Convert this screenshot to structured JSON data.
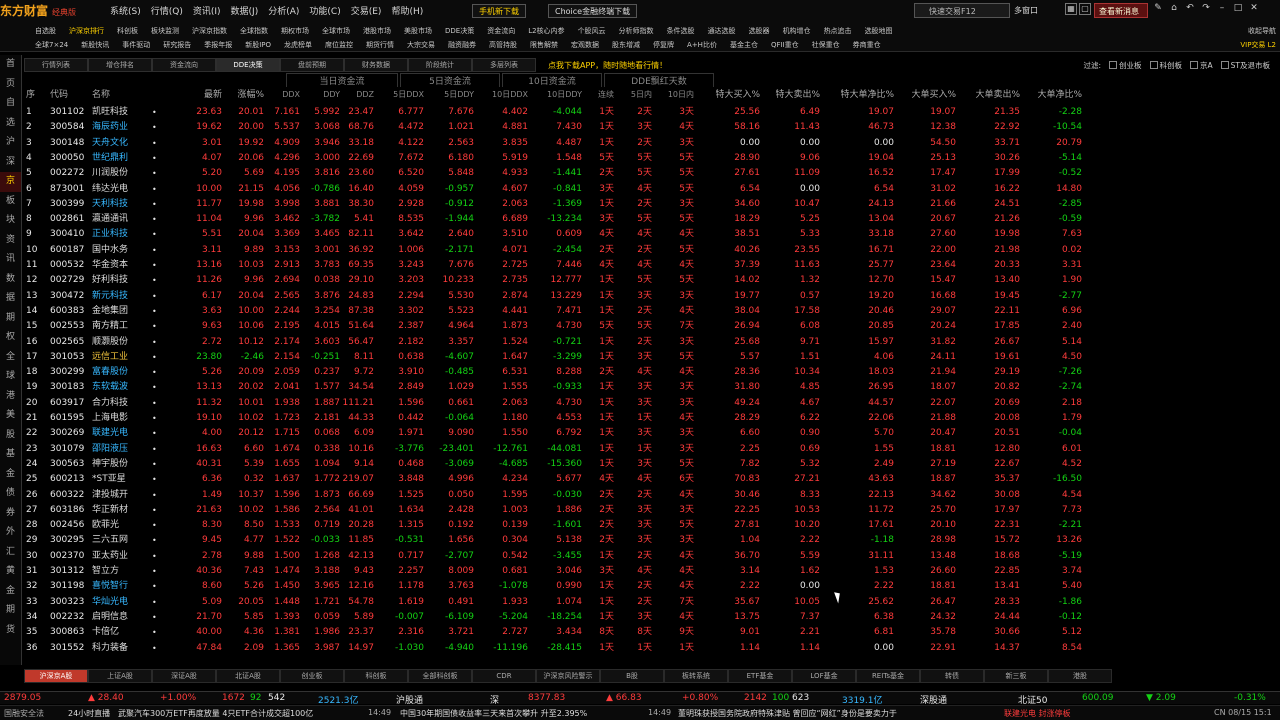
{
  "app": {
    "logo": "东方财富",
    "edition": "经典版"
  },
  "menu": [
    "系统(S)",
    "行情(Q)",
    "资讯(I)",
    "数据(J)",
    "分析(A)",
    "功能(C)",
    "交易(E)",
    "帮助(H)"
  ],
  "top_buttons": {
    "mobile": "手机新下载",
    "choice": "Choice金融终端下载"
  },
  "search_placeholder": "快速交易F12",
  "multi_window": "多窗口",
  "message_btn": "查看新消息",
  "subnav_row1": [
    "自选股",
    "沪深京排行",
    "科创板",
    "板块监测",
    "沪深京指数",
    "全球指数",
    "期权市场",
    "全球市场",
    "港股市场",
    "美股市场",
    "DDE决策",
    "资金流向",
    "L2核心内参",
    "个股风云",
    "分析师指数",
    "条件选股",
    "通达选股",
    "选股器",
    "机构增仓",
    "热点追击",
    "选股地图"
  ],
  "subnav_row2": [
    "全球7×24",
    "新股快讯",
    "事件驱动",
    "研究报告",
    "季报年报",
    "新股IPO",
    "龙虎榜单",
    "席位监控",
    "期货行情",
    "大宗交易",
    "融资融券",
    "高管持股",
    "限售解禁",
    "宏观数据",
    "股东增减",
    "停复牌",
    "A+H比价",
    "基金主仓",
    "QFII重仓",
    "社保重仓",
    "券商重仓"
  ],
  "right_nav1": "收起导航",
  "right_nav2": "VIP交易 L2",
  "sidebar": [
    "首",
    "页",
    "自",
    "选",
    "沪",
    "深",
    "京",
    "板",
    "块",
    "资",
    "讯",
    "数",
    "据",
    "期",
    "权",
    "全",
    "球",
    "港",
    "美",
    "股",
    "基",
    "金",
    "债",
    "券",
    "外",
    "汇",
    "黄",
    "金",
    "期",
    "货"
  ],
  "tabs": [
    "行情列表",
    "增仓排名",
    "资金流向",
    "DDE决策",
    "盘前预期",
    "财务数据",
    "阶段统计",
    "多层列表"
  ],
  "active_tab": 3,
  "promo": "点我下载APP，随时随地看行情！",
  "filters": {
    "label": "过滤:",
    "items": [
      "创业板",
      "科创板",
      "京A",
      "ST及退市板"
    ]
  },
  "header_groups": {
    "today": "当日资金流",
    "five_day": "5日资金流",
    "ten_day": "10日资金流",
    "dde_days": "DDE飘红天数"
  },
  "columns": [
    "序",
    "代码",
    "名称",
    "",
    "最新",
    "涨幅%",
    "DDX",
    "DDY",
    "DDZ",
    "5日DDX",
    "5日DDY",
    "10日DDX",
    "10日DDY",
    "连续",
    "5日内",
    "10日内",
    "特大买入%",
    "特大卖出%",
    "特大单净比%",
    "大单买入%",
    "大单卖出%",
    "大单净比%"
  ],
  "rows": [
    [
      "1",
      "301102",
      "凯旺科技",
      "•",
      "23.63",
      "20.01",
      "7.161",
      "5.992",
      "23.47",
      "6.777",
      "7.676",
      "4.402",
      "-4.044",
      "1天",
      "2天",
      "3天",
      "25.56",
      "6.49",
      "19.07",
      "19.07",
      "21.35",
      "-2.28"
    ],
    [
      "2",
      "300584",
      "海辰药业",
      "•",
      "19.62",
      "20.00",
      "5.537",
      "3.068",
      "68.76",
      "4.472",
      "1.021",
      "4.881",
      "7.430",
      "1天",
      "3天",
      "4天",
      "58.16",
      "11.43",
      "46.73",
      "12.38",
      "22.92",
      "-10.54"
    ],
    [
      "3",
      "300148",
      "天舟文化",
      "•",
      "3.01",
      "19.92",
      "4.909",
      "3.946",
      "33.18",
      "4.122",
      "2.563",
      "3.835",
      "4.487",
      "1天",
      "2天",
      "3天",
      "0.00",
      "0.00",
      "0.00",
      "54.50",
      "33.71",
      "20.79"
    ],
    [
      "4",
      "300050",
      "世纪鼎利",
      "•",
      "4.07",
      "20.06",
      "4.296",
      "3.000",
      "22.69",
      "7.672",
      "6.180",
      "5.919",
      "1.548",
      "5天",
      "5天",
      "5天",
      "28.90",
      "9.06",
      "19.04",
      "25.13",
      "30.26",
      "-5.14"
    ],
    [
      "5",
      "002272",
      "川润股份",
      "•",
      "5.20",
      "5.69",
      "4.195",
      "3.816",
      "23.60",
      "6.520",
      "5.848",
      "4.933",
      "-1.441",
      "2天",
      "5天",
      "5天",
      "27.61",
      "11.09",
      "16.52",
      "17.47",
      "17.99",
      "-0.52"
    ],
    [
      "6",
      "873001",
      "纬达光电",
      "•",
      "10.00",
      "21.15",
      "4.056",
      "-0.786",
      "16.40",
      "4.059",
      "-0.957",
      "4.607",
      "-0.841",
      "3天",
      "4天",
      "5天",
      "6.54",
      "0.00",
      "6.54",
      "31.02",
      "16.22",
      "14.80"
    ],
    [
      "7",
      "300399",
      "天利科技",
      "•",
      "11.77",
      "19.98",
      "3.998",
      "3.881",
      "38.30",
      "2.928",
      "-0.912",
      "2.063",
      "-1.369",
      "1天",
      "2天",
      "3天",
      "34.60",
      "10.47",
      "24.13",
      "21.66",
      "24.51",
      "-2.85"
    ],
    [
      "8",
      "002861",
      "瀛通通讯",
      "•",
      "11.04",
      "9.96",
      "3.462",
      "-3.782",
      "5.41",
      "8.535",
      "-1.944",
      "6.689",
      "-13.234",
      "3天",
      "5天",
      "5天",
      "18.29",
      "5.25",
      "13.04",
      "20.67",
      "21.26",
      "-0.59"
    ],
    [
      "9",
      "300410",
      "正业科技",
      "•",
      "5.51",
      "20.04",
      "3.369",
      "3.465",
      "82.11",
      "3.642",
      "2.640",
      "3.510",
      "0.609",
      "4天",
      "4天",
      "4天",
      "38.51",
      "5.33",
      "33.18",
      "27.60",
      "19.98",
      "7.63"
    ],
    [
      "10",
      "600187",
      "国中水务",
      "•",
      "3.11",
      "9.89",
      "3.153",
      "3.001",
      "36.92",
      "1.006",
      "-2.171",
      "4.071",
      "-2.454",
      "2天",
      "2天",
      "5天",
      "40.26",
      "23.55",
      "16.71",
      "22.00",
      "21.98",
      "0.02"
    ],
    [
      "11",
      "000532",
      "华金资本",
      "•",
      "13.16",
      "10.03",
      "2.913",
      "3.783",
      "69.35",
      "3.243",
      "7.676",
      "2.725",
      "7.446",
      "4天",
      "4天",
      "4天",
      "37.39",
      "11.63",
      "25.77",
      "23.64",
      "20.33",
      "3.31"
    ],
    [
      "12",
      "002729",
      "好利科技",
      "•",
      "11.26",
      "9.96",
      "2.694",
      "0.038",
      "29.10",
      "3.203",
      "10.233",
      "2.735",
      "12.777",
      "1天",
      "5天",
      "5天",
      "14.02",
      "1.32",
      "12.70",
      "15.47",
      "13.40",
      "1.90"
    ],
    [
      "13",
      "300472",
      "新元科技",
      "•",
      "6.17",
      "20.04",
      "2.565",
      "3.876",
      "24.83",
      "2.294",
      "5.530",
      "2.874",
      "13.229",
      "1天",
      "3天",
      "3天",
      "19.77",
      "0.57",
      "19.20",
      "16.68",
      "19.45",
      "-2.77"
    ],
    [
      "14",
      "600383",
      "金地集团",
      "•",
      "3.63",
      "10.00",
      "2.244",
      "3.254",
      "87.38",
      "3.302",
      "5.523",
      "4.441",
      "7.471",
      "1天",
      "2天",
      "4天",
      "38.04",
      "17.58",
      "20.46",
      "29.07",
      "22.11",
      "6.96"
    ],
    [
      "15",
      "002553",
      "南方精工",
      "•",
      "9.63",
      "10.06",
      "2.195",
      "4.015",
      "51.64",
      "2.387",
      "4.964",
      "1.873",
      "4.730",
      "5天",
      "5天",
      "7天",
      "26.94",
      "6.08",
      "20.85",
      "20.24",
      "17.85",
      "2.40"
    ],
    [
      "16",
      "002565",
      "顺灏股份",
      "•",
      "2.72",
      "10.12",
      "2.174",
      "3.603",
      "56.47",
      "2.182",
      "3.357",
      "1.524",
      "-0.721",
      "1天",
      "2天",
      "3天",
      "25.68",
      "9.71",
      "15.97",
      "31.82",
      "26.67",
      "5.14"
    ],
    [
      "17",
      "301053",
      "远信工业",
      "•",
      "23.80",
      "-2.46",
      "2.154",
      "-0.251",
      "8.11",
      "0.638",
      "-4.607",
      "1.647",
      "-3.299",
      "1天",
      "3天",
      "5天",
      "5.57",
      "1.51",
      "4.06",
      "24.11",
      "19.61",
      "4.50"
    ],
    [
      "18",
      "300299",
      "富春股份",
      "•",
      "5.26",
      "20.09",
      "2.059",
      "0.237",
      "9.72",
      "3.910",
      "-0.485",
      "6.531",
      "8.288",
      "2天",
      "4天",
      "4天",
      "28.36",
      "10.34",
      "18.03",
      "21.94",
      "29.19",
      "-7.26"
    ],
    [
      "19",
      "300183",
      "东软载波",
      "•",
      "13.13",
      "20.02",
      "2.041",
      "1.577",
      "34.54",
      "2.849",
      "1.029",
      "1.555",
      "-0.933",
      "1天",
      "3天",
      "3天",
      "31.80",
      "4.85",
      "26.95",
      "18.07",
      "20.82",
      "-2.74"
    ],
    [
      "20",
      "603917",
      "合力科技",
      "•",
      "11.32",
      "10.01",
      "1.938",
      "1.887",
      "111.21",
      "1.596",
      "0.661",
      "2.063",
      "4.730",
      "1天",
      "3天",
      "3天",
      "49.24",
      "4.67",
      "44.57",
      "22.07",
      "20.69",
      "2.18"
    ],
    [
      "21",
      "601595",
      "上海电影",
      "•",
      "19.10",
      "10.02",
      "1.723",
      "2.181",
      "44.33",
      "0.442",
      "-0.064",
      "1.180",
      "4.553",
      "1天",
      "1天",
      "4天",
      "28.29",
      "6.22",
      "22.06",
      "21.88",
      "20.08",
      "1.79"
    ],
    [
      "22",
      "300269",
      "联建光电",
      "•",
      "4.00",
      "20.12",
      "1.715",
      "0.068",
      "6.09",
      "1.971",
      "9.090",
      "1.550",
      "6.792",
      "1天",
      "3天",
      "3天",
      "6.60",
      "0.90",
      "5.70",
      "20.47",
      "20.51",
      "-0.04"
    ],
    [
      "23",
      "301079",
      "邵阳液压",
      "•",
      "16.63",
      "6.60",
      "1.674",
      "0.338",
      "10.16",
      "-3.776",
      "-23.401",
      "-12.761",
      "-44.081",
      "1天",
      "1天",
      "3天",
      "2.25",
      "0.69",
      "1.55",
      "18.81",
      "12.80",
      "6.01"
    ],
    [
      "24",
      "300563",
      "神宇股份",
      "•",
      "40.31",
      "5.39",
      "1.655",
      "1.094",
      "9.14",
      "0.468",
      "-3.069",
      "-4.685",
      "-15.360",
      "1天",
      "3天",
      "5天",
      "7.82",
      "5.32",
      "2.49",
      "27.19",
      "22.67",
      "4.52"
    ],
    [
      "25",
      "600213",
      "*ST亚星",
      "•",
      "6.36",
      "0.32",
      "1.637",
      "1.772",
      "219.07",
      "3.848",
      "4.996",
      "4.234",
      "5.677",
      "4天",
      "4天",
      "6天",
      "70.83",
      "27.21",
      "43.63",
      "18.87",
      "35.37",
      "-16.50"
    ],
    [
      "26",
      "600322",
      "津投城开",
      "•",
      "1.49",
      "10.37",
      "1.596",
      "1.873",
      "66.69",
      "1.525",
      "0.050",
      "1.595",
      "-0.030",
      "2天",
      "2天",
      "4天",
      "30.46",
      "8.33",
      "22.13",
      "34.62",
      "30.08",
      "4.54"
    ],
    [
      "27",
      "603186",
      "华正新材",
      "•",
      "21.63",
      "10.02",
      "1.586",
      "2.564",
      "41.01",
      "1.634",
      "2.428",
      "1.003",
      "1.886",
      "2天",
      "3天",
      "3天",
      "22.25",
      "10.53",
      "11.72",
      "25.70",
      "17.97",
      "7.73"
    ],
    [
      "28",
      "002456",
      "欧菲光",
      "•",
      "8.30",
      "8.50",
      "1.533",
      "0.719",
      "20.28",
      "1.315",
      "0.192",
      "0.139",
      "-1.601",
      "2天",
      "3天",
      "5天",
      "27.81",
      "10.20",
      "17.61",
      "20.10",
      "22.31",
      "-2.21"
    ],
    [
      "29",
      "300295",
      "三六五网",
      "•",
      "9.45",
      "4.77",
      "1.522",
      "-0.033",
      "11.85",
      "-0.531",
      "1.656",
      "0.304",
      "5.138",
      "2天",
      "3天",
      "3天",
      "1.04",
      "2.22",
      "-1.18",
      "28.98",
      "15.72",
      "13.26"
    ],
    [
      "30",
      "002370",
      "亚太药业",
      "•",
      "2.78",
      "9.88",
      "1.500",
      "1.268",
      "42.13",
      "0.717",
      "-2.707",
      "0.542",
      "-3.455",
      "1天",
      "2天",
      "4天",
      "36.70",
      "5.59",
      "31.11",
      "13.48",
      "18.68",
      "-5.19"
    ],
    [
      "31",
      "301312",
      "智立方",
      "•",
      "40.36",
      "7.43",
      "1.474",
      "3.188",
      "9.43",
      "2.257",
      "8.009",
      "0.681",
      "3.046",
      "3天",
      "4天",
      "4天",
      "3.14",
      "1.62",
      "1.53",
      "26.60",
      "22.85",
      "3.74"
    ],
    [
      "32",
      "301198",
      "喜悦智行",
      "•",
      "8.60",
      "5.26",
      "1.450",
      "3.965",
      "12.16",
      "1.178",
      "3.763",
      "-1.078",
      "0.990",
      "1天",
      "2天",
      "4天",
      "2.22",
      "0.00",
      "2.22",
      "18.81",
      "13.41",
      "5.40"
    ],
    [
      "33",
      "300323",
      "华灿光电",
      "•",
      "5.09",
      "20.05",
      "1.448",
      "1.721",
      "54.78",
      "1.619",
      "0.491",
      "1.933",
      "1.074",
      "1天",
      "2天",
      "7天",
      "35.67",
      "10.05",
      "25.62",
      "26.47",
      "28.33",
      "-1.86"
    ],
    [
      "34",
      "002232",
      "启明信息",
      "•",
      "21.70",
      "5.85",
      "1.393",
      "0.059",
      "5.89",
      "-0.007",
      "-6.109",
      "-5.204",
      "-18.254",
      "1天",
      "3天",
      "4天",
      "13.75",
      "7.37",
      "6.38",
      "24.32",
      "24.44",
      "-0.12"
    ],
    [
      "35",
      "300863",
      "卡倍亿",
      "•",
      "40.00",
      "4.36",
      "1.381",
      "1.986",
      "23.37",
      "2.316",
      "3.721",
      "2.727",
      "3.434",
      "8天",
      "8天",
      "9天",
      "9.01",
      "2.21",
      "6.81",
      "35.78",
      "30.66",
      "5.12"
    ],
    [
      "36",
      "301552",
      "科力装备",
      "•",
      "47.84",
      "2.09",
      "1.365",
      "3.987",
      "14.97",
      "-1.030",
      "-4.940",
      "-11.196",
      "-28.415",
      "1天",
      "1天",
      "1天",
      "1.14",
      "1.14",
      "0.00",
      "22.91",
      "14.37",
      "8.54"
    ]
  ],
  "name_colors": {
    "2": "cy",
    "3": "cy",
    "4": "cy",
    "7": "cy",
    "9": "cy",
    "13": "cy",
    "17": "y",
    "18": "cy",
    "19": "cy",
    "22": "cy",
    "23": "cy",
    "32": "cy",
    "33": "cy"
  },
  "bottom_tabs": [
    "沪深京A股",
    "上证A股",
    "深证A股",
    "北证A股",
    "创业板",
    "科创板",
    "全部科创板",
    "CDR",
    "沪深京风险警示",
    "B股",
    "板转系统",
    "ETF基金",
    "LOF基金",
    "REITs基金",
    "转债",
    "新三板",
    "港股"
  ],
  "ticker": {
    "sh_idx": "2879.05",
    "sh_chg": "▲ 28.40",
    "sh_pct": "+1.00%",
    "sh_up": "1672",
    "sh_down": "92",
    "sh_flat": "542",
    "sh_amt": "2521.3亿",
    "sh_connect_label": "沪股通",
    "sz_label": "深",
    "sz_idx": "8377.83",
    "sz_chg": "▲ 66.83",
    "sz_pct": "+0.80%",
    "sz_up": "2142",
    "sz_down": "100",
    "sz_flat": "623",
    "sz_amt": "3319.1亿",
    "sz_connect_label": "深股通",
    "bj_label": "北证50",
    "bj_idx": "600.09",
    "bj_chg": "▼ 2.09",
    "bj_pct": "-0.31%"
  },
  "status": {
    "left": "国融安全法",
    "news1": "24小时直播",
    "news1_text": "武聚汽车300万ETF再度放量  4只ETF合计成交超100亿",
    "time1": "14:49",
    "news2_text": "中国30年期国债收益率三天来首次攀升  升至2.395%",
    "time2": "14:49",
    "news3_text": "董明珠获授国务院政府特殊津贴  曾回应“网红”身份是要卖力于",
    "alert": "联建光电  封涨停板",
    "clock": "CN 08/15 15:1"
  },
  "colors": {
    "up": "#ff3c3c",
    "down": "#14d214",
    "accent": "#ffd200",
    "bg": "#000000"
  }
}
